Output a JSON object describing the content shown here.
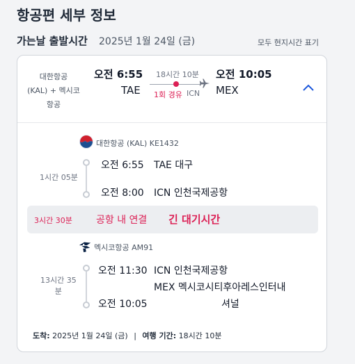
{
  "page_title": "항공편 세부 정보",
  "section": {
    "heading": "가는날 출발시간",
    "date": "2025년 1월 24일 (금)",
    "timezone_note": "모두 현지시간 표기"
  },
  "summary": {
    "airline_line1": "대한항공",
    "airline_line2": "(KAL) + 멕시코",
    "airline_line3": "항공",
    "depart_time": "오전 6:55",
    "depart_code": "TAE",
    "total_duration": "18시간 10분",
    "stops": "1회 경유",
    "stop_code": "ICN",
    "arrive_time": "오전 10:05",
    "arrive_code": "MEX",
    "expand_icon": "chevron-up-icon"
  },
  "segment1": {
    "carrier": "대한항공 (KAL) KE1432",
    "duration": "1시간 05분",
    "dep_time": "오전 6:55",
    "dep_place": "TAE 대구",
    "arr_time": "오전 8:00",
    "arr_place": "ICN 인천국제공항"
  },
  "layover": {
    "duration": "3시간 30분",
    "connection": "공항 내 연결",
    "long_wait": "긴 대기시간"
  },
  "segment2": {
    "carrier": "멕시코항공 AM91",
    "duration_line1": "13시간 35",
    "duration_line2": "분",
    "dep_time": "오전 11:30",
    "dep_place": "ICN 인천국제공항",
    "arr_time": "오전 10:05",
    "arr_place_line1": "MEX 멕시코시티후아레스인터내",
    "arr_place_line2": "셔널"
  },
  "footer": {
    "arrival_label": "도착:",
    "arrival_value": "2025년 1월 24일 (금)",
    "separator": "|",
    "travel_label": "여행 기간:",
    "travel_value": "18시간 10분"
  },
  "colors": {
    "accent_pink": "#dc2055",
    "link_blue": "#1a56db",
    "korean_air_blue": "#1d4f91",
    "korean_air_red": "#d0202e",
    "aeromexico_navy": "#0b2345"
  }
}
